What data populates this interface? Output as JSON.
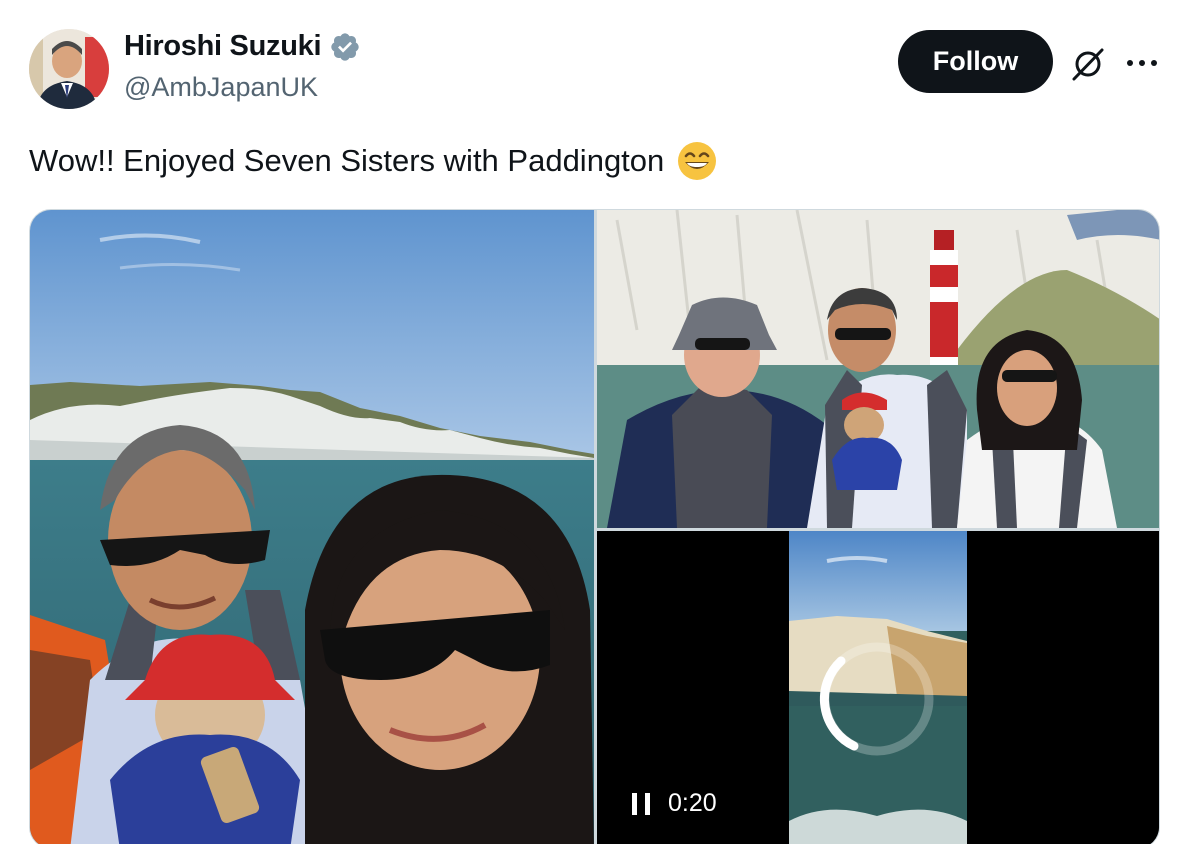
{
  "author": {
    "name": "Hiroshi Suzuki",
    "handle": "@AmbJapanUK",
    "verified": true,
    "avatar_icon": "profile-photo"
  },
  "actions": {
    "follow_label": "Follow",
    "grok_icon": "grok-icon",
    "more_icon": "more-icon"
  },
  "tweet": {
    "text": "Wow!!  Enjoyed Seven Sisters with Paddington",
    "emoji": "grinning-face-with-smiling-eyes"
  },
  "media": {
    "video": {
      "time": "0:20",
      "state_icon": "pause-icon"
    }
  },
  "colors": {
    "text": "#0f1419",
    "secondary": "#536471",
    "verified": "#829aab",
    "follow_bg": "#0f1419"
  }
}
